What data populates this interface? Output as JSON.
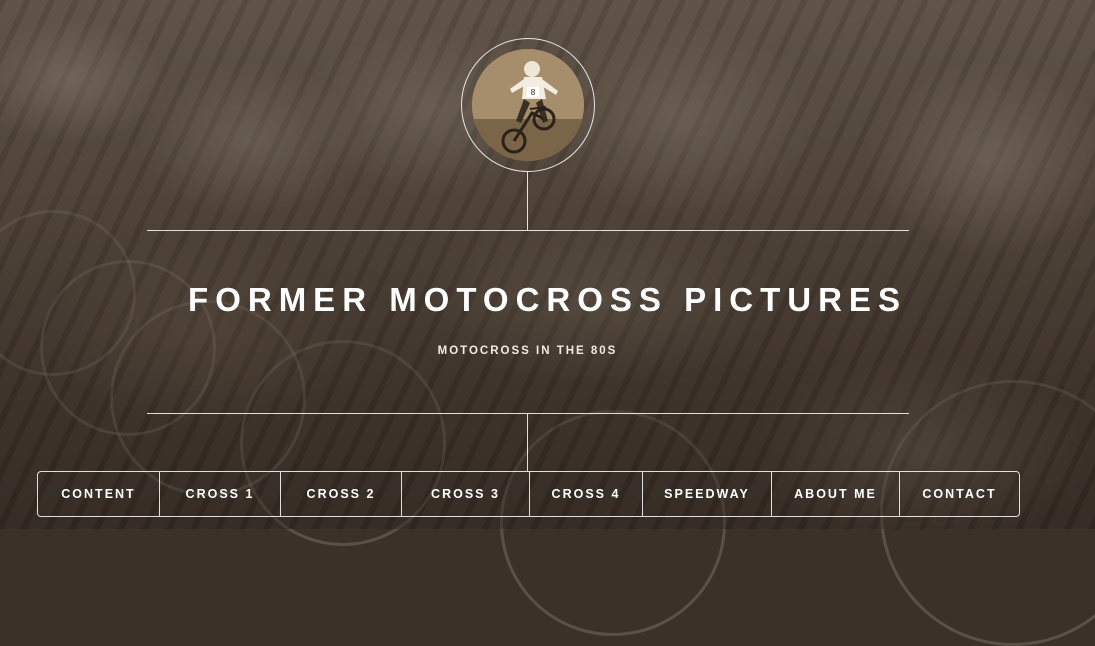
{
  "site": {
    "title": "FORMER MOTOCROSS PICTURES",
    "subtitle": "MOTOCROSS IN THE 80S"
  },
  "avatar": {
    "description": "rider-on-motocross-bike-icon",
    "number": "8"
  },
  "nav": {
    "items": [
      {
        "label": "CONTENT"
      },
      {
        "label": "CROSS 1"
      },
      {
        "label": "CROSS 2"
      },
      {
        "label": "CROSS 3"
      },
      {
        "label": "CROSS 4"
      },
      {
        "label": "SPEEDWAY"
      },
      {
        "label": "ABOUT ME"
      },
      {
        "label": "CONTACT"
      }
    ]
  },
  "colors": {
    "text": "#ffffff",
    "background_tone": "#3b3128",
    "sepia": "#9d8666"
  }
}
